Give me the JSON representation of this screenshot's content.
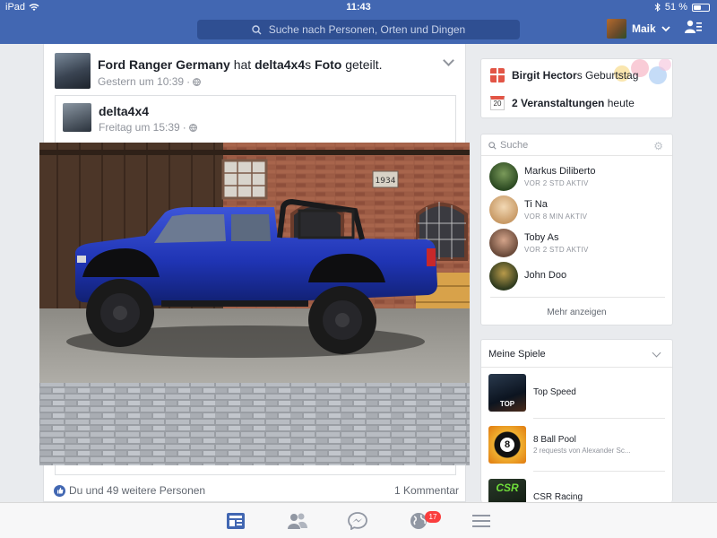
{
  "status_bar": {
    "device": "iPad",
    "time": "11:43",
    "battery": "51 %",
    "battery_level": 0.51
  },
  "header": {
    "search_placeholder": "Suche nach Personen, Orten und Dingen",
    "profile_name": "Maik"
  },
  "post": {
    "page_name": "Ford Ranger Germany",
    "verb": "hat",
    "shared_from": "delta4x4",
    "possessive": "s",
    "object": "Foto",
    "action": "geteilt.",
    "timestamp": "Gestern um 10:39",
    "shared": {
      "name": "delta4x4",
      "timestamp": "Freitag um 15:39"
    },
    "photo_caption_sign": "1934",
    "reactions": "Du und 49 weitere Personen",
    "comments": "1 Kommentar"
  },
  "events": {
    "birthday_name": "Birgit Hector",
    "birthday_suffix": "s Geburtstag",
    "calendar_day": "20",
    "events_count": "2 Veranstaltungen",
    "events_suffix": "heute"
  },
  "contacts": {
    "search_label": "Suche",
    "items": [
      {
        "name": "Markus Diliberto",
        "status": "VOR 2 STD AKTIV"
      },
      {
        "name": "Ti Na",
        "status": "VOR 8 MIN AKTIV"
      },
      {
        "name": "Toby As",
        "status": "VOR 2 STD AKTIV"
      },
      {
        "name": "John Doo",
        "status": ""
      }
    ],
    "more_label": "Mehr anzeigen"
  },
  "games": {
    "title": "Meine Spiele",
    "items": [
      {
        "name": "Top Speed",
        "sub": "",
        "icon_text": "TOP"
      },
      {
        "name": "8 Ball Pool",
        "sub": "2 requests von Alexander Sc...",
        "icon_text": "8"
      },
      {
        "name": "CSR Racing",
        "sub": "",
        "icon_text": "CSR"
      }
    ]
  },
  "tabbar": {
    "notifications_badge": "17"
  },
  "colors": {
    "facebook_blue": "#4267b2",
    "badge_red": "#fa3e3e"
  }
}
